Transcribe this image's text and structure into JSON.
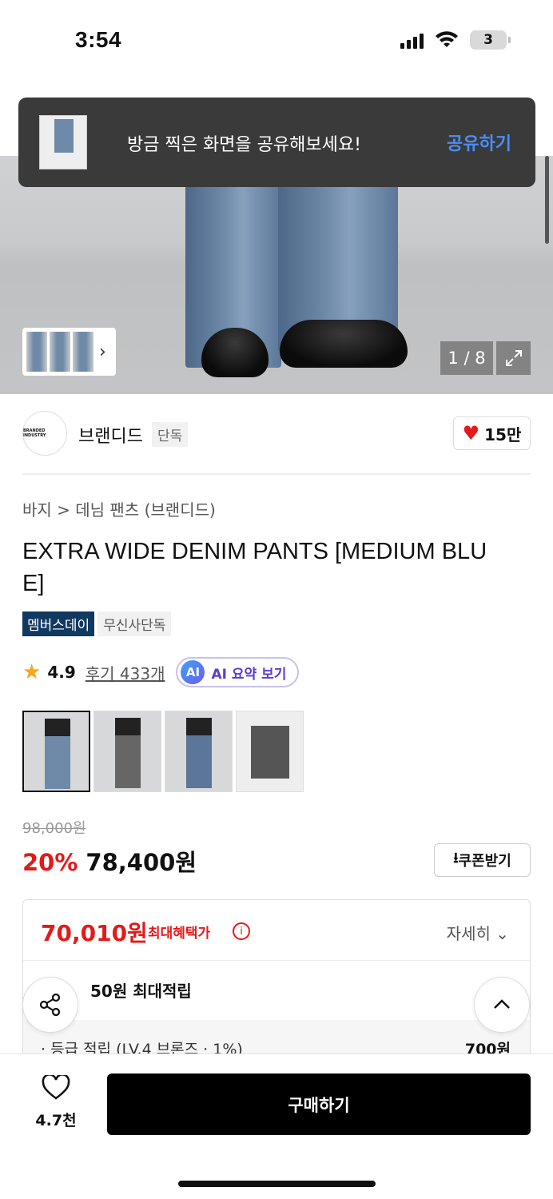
{
  "status_bar": {
    "time": "3:54",
    "battery": "3"
  },
  "toast": {
    "message": "방금 찍은 화면을 공유해보세요!",
    "action": "공유하기"
  },
  "gallery": {
    "counter": "1 / 8"
  },
  "brand": {
    "logo_text": "BRANDED INDUSTRY",
    "name": "브랜디드",
    "tag": "단독",
    "likes": "15만"
  },
  "breadcrumb": "바지 > 데님 팬츠 (브랜디드)",
  "product": {
    "title": "EXTRA WIDE DENIM PANTS [MEDIUM BLU\nE]"
  },
  "badges": [
    "멤버스데이",
    "무신사단독"
  ],
  "rating": {
    "score": "4.9",
    "reviews": "후기 433개",
    "ai_badge": "AI",
    "ai_label": "AI 요약 보기"
  },
  "price": {
    "original": "98,000원",
    "discount": "20%",
    "sale": "78,400원",
    "coupon_label": "쿠폰받기"
  },
  "benefit": {
    "best_price": "70,010원",
    "best_label": "최대혜택가",
    "detail_label": "자세히",
    "points": "50원 최대적립",
    "grade_label": "· 등급 적립 (LV.4 브론즈 · 1%)",
    "grade_value": "700원"
  },
  "bottom": {
    "wish_count": "4.7천",
    "buy_label": "구매하기"
  },
  "colors": {
    "accent_red": "#e51919",
    "member_badge": "#10395f",
    "toast_action": "#4a8df8",
    "ai_purple": "#5b3bd6"
  }
}
